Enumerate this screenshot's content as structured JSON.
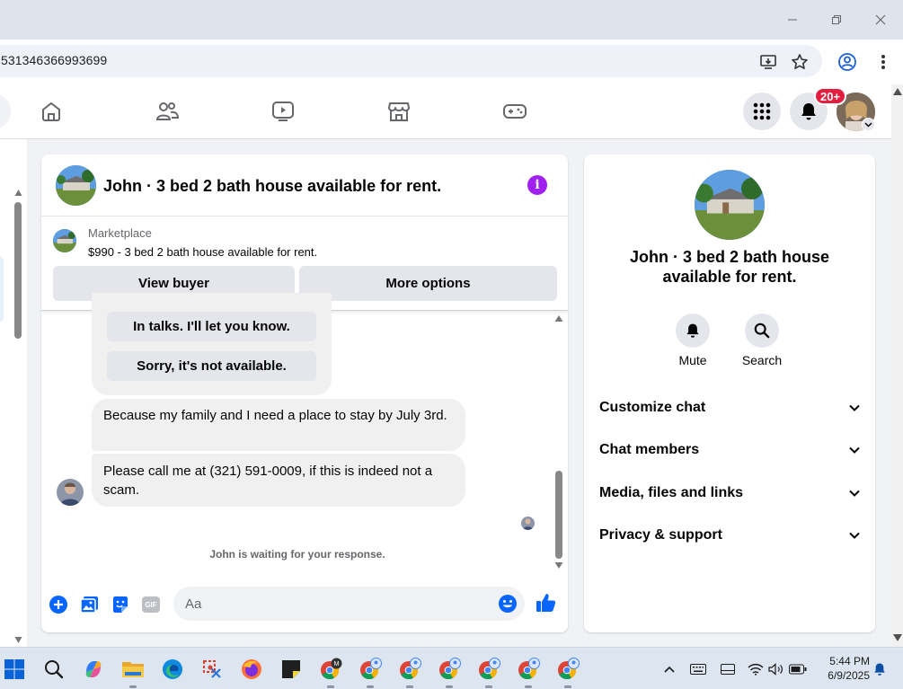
{
  "browser": {
    "url": "531346366993699"
  },
  "fb_nav": {
    "notification_count": "20+"
  },
  "chat": {
    "title": "John · 3 bed 2 bath house available for rent.",
    "marketplace": {
      "label": "Marketplace",
      "listing": "$990 - 3 bed 2 bath house available for rent."
    },
    "actions": {
      "view_buyer": "View buyer",
      "more_options": "More options"
    },
    "quick_replies": [
      "In talks. I'll let you know.",
      "Sorry, it's not available."
    ],
    "messages": [
      {
        "text": "Because my family and I need a place to stay by July 3rd."
      },
      {
        "text": "Please call me at (321) 591-0009, if this is indeed not a scam."
      }
    ],
    "waiting_notice": "John is waiting for your response.",
    "composer": {
      "placeholder": "Aa",
      "gif_label": "GIF"
    }
  },
  "info_panel": {
    "title": "John · 3 bed 2 bath house available for rent.",
    "actions": {
      "mute": "Mute",
      "search": "Search"
    },
    "sections": [
      "Customize chat",
      "Chat members",
      "Media, files and links",
      "Privacy & support"
    ]
  },
  "taskbar": {
    "time": "5:44 PM",
    "date": "6/9/2025"
  },
  "colors": {
    "messenger_blue": "#0866ff",
    "info_purple": "#a020f0",
    "badge_red": "#e41e3f"
  }
}
